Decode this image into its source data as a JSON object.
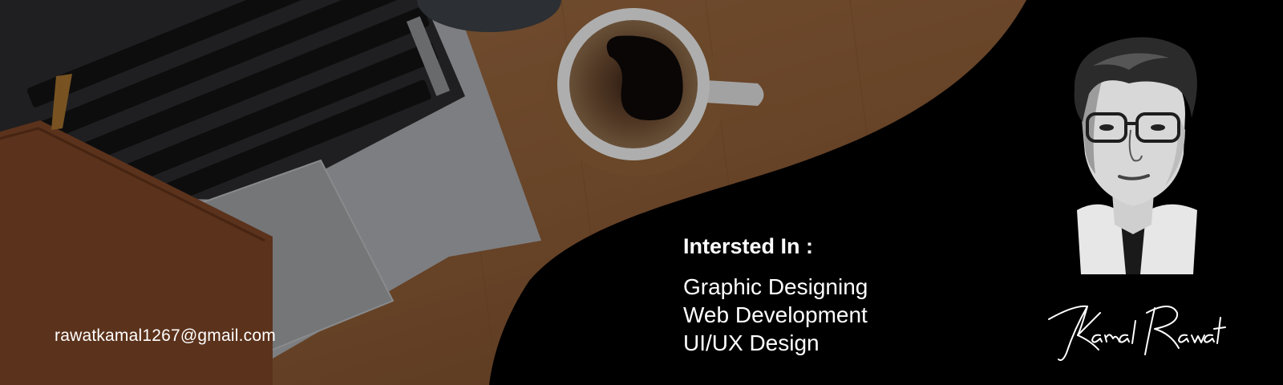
{
  "contact": {
    "email": "rawatkamal1267@gmail.com"
  },
  "interests": {
    "heading": "Intersted In :",
    "items": [
      "Graphic Designing",
      "Web Development",
      "UI/UX Design"
    ]
  },
  "signature": {
    "text": "Kamal Rawat"
  },
  "icons": {
    "photo": "laptop-coffee-desk-photo",
    "portrait": "person-portrait-illustration",
    "signature": "handwritten-signature"
  },
  "colors": {
    "background": "#000000",
    "desk_wood": "#8a5a35",
    "text": "#ffffff"
  }
}
